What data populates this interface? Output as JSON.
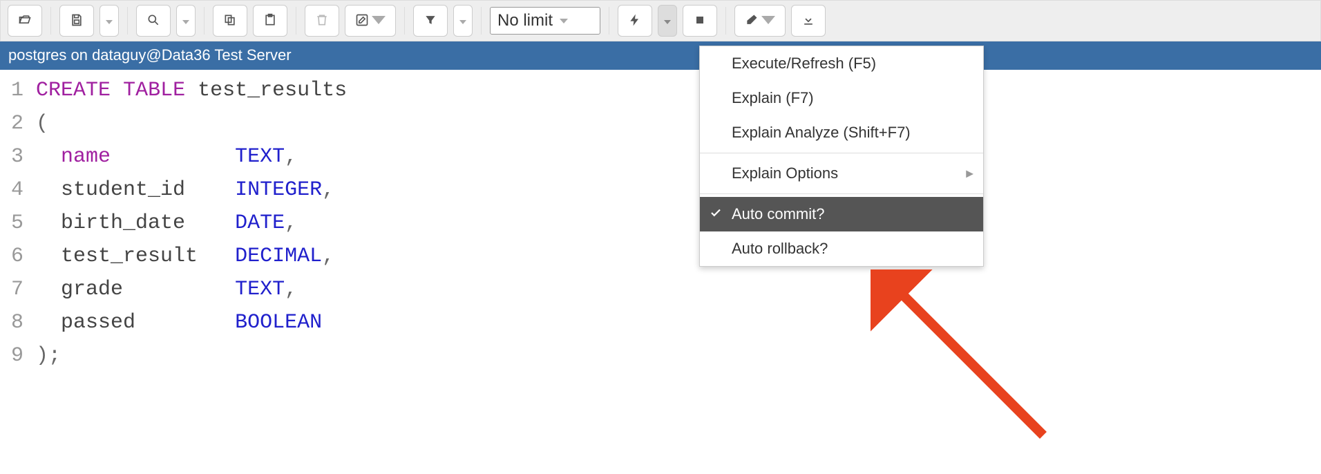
{
  "toolbar": {
    "limit_label": "No limit"
  },
  "connection_bar": "postgres on dataguy@Data36 Test Server",
  "code": {
    "line_numbers": [
      "1",
      "2",
      "3",
      "4",
      "5",
      "6",
      "7",
      "8",
      "9"
    ],
    "l1_kw1": "CREATE",
    "l1_kw2": "TABLE",
    "l1_ident": "test_results",
    "l2": "(",
    "l3_col": "name",
    "l3_type": "TEXT",
    "l4_col": "student_id",
    "l4_type": "INTEGER",
    "l5_col": "birth_date",
    "l5_type": "DATE",
    "l6_col": "test_result",
    "l6_type": "DECIMAL",
    "l7_col": "grade",
    "l7_type": "TEXT",
    "l8_col": "passed",
    "l8_type": "BOOLEAN",
    "l9": ");",
    "comma": ","
  },
  "menu": {
    "execute": "Execute/Refresh (F5)",
    "explain": "Explain (F7)",
    "explain_analyze": "Explain Analyze (Shift+F7)",
    "explain_options": "Explain Options",
    "auto_commit": "Auto commit?",
    "auto_rollback": "Auto rollback?"
  }
}
